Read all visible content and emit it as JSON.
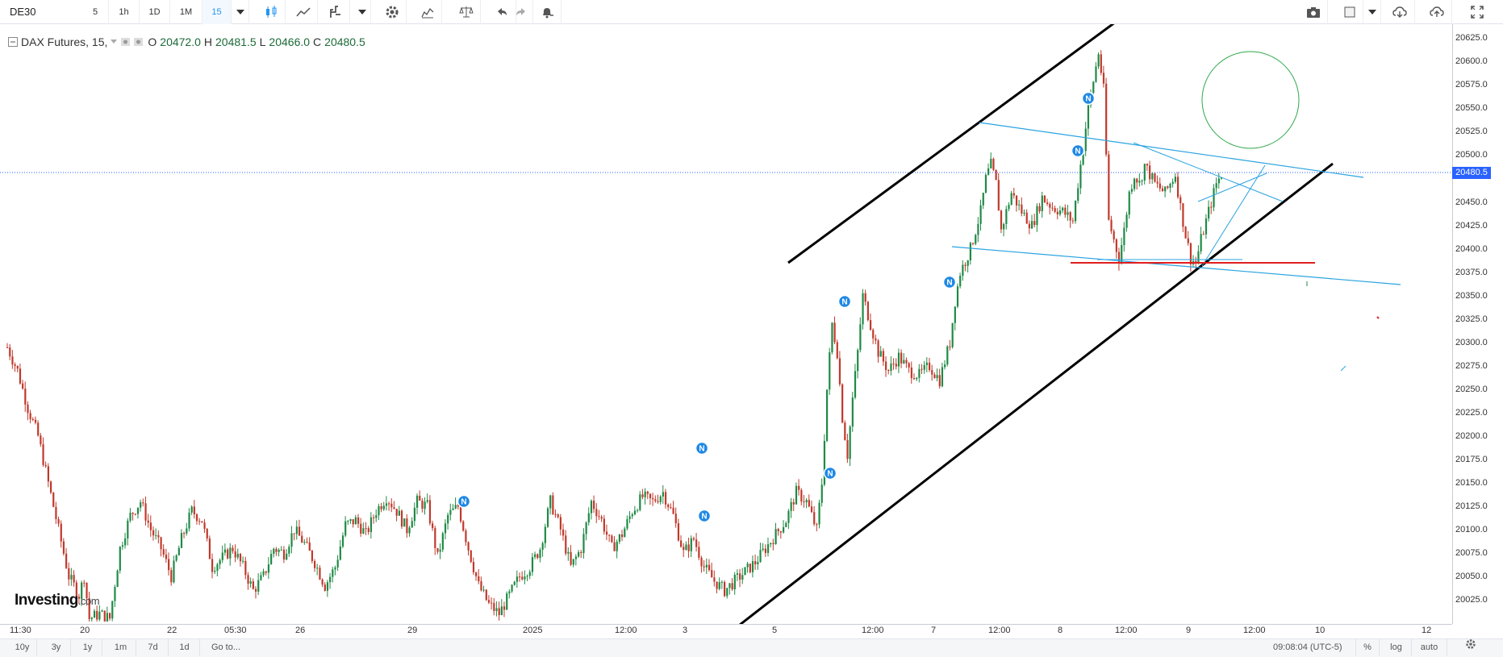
{
  "toolbar": {
    "symbol": "DE30",
    "intervals": [
      "5",
      "1h",
      "1D",
      "1M",
      "15"
    ],
    "active_interval": "15"
  },
  "legend": {
    "name": "DAX Futures, 15,",
    "open_label": "O",
    "open": "20472.0",
    "high_label": "H",
    "high": "20481.5",
    "low_label": "L",
    "low": "20466.0",
    "close_label": "C",
    "close": "20480.5"
  },
  "price_axis": {
    "labels": [
      "20625.0",
      "20600.0",
      "20575.0",
      "20550.0",
      "20525.0",
      "20500.0",
      "20450.0",
      "20425.0",
      "20400.0",
      "20375.0",
      "20350.0",
      "20325.0",
      "20300.0",
      "20275.0",
      "20250.0",
      "20225.0",
      "20200.0",
      "20175.0",
      "20150.0",
      "20125.0",
      "20100.0",
      "20075.0",
      "20050.0",
      "20025.0"
    ],
    "current_price": "20480.5"
  },
  "time_axis": {
    "labels": [
      "11:30",
      "20",
      "22",
      "05:30",
      "26",
      "29",
      "2025",
      "12:00",
      "3",
      "5",
      "12:00",
      "7",
      "12:00",
      "8",
      "12:00",
      "9",
      "12:00",
      "10",
      "12"
    ]
  },
  "bottom_bar": {
    "ranges": [
      "10y",
      "3y",
      "1y",
      "1m",
      "7d",
      "1d"
    ],
    "goto": "Go to...",
    "clock": "09:08:04 (UTC-5)",
    "percent": "%",
    "log": "log",
    "auto": "auto"
  },
  "logo": {
    "brand": "Investing",
    "suffix": ".com"
  },
  "news_marker": "N",
  "colors": {
    "up": "#1f8a45",
    "down": "#c0392b",
    "channel": "#000000",
    "trendline": "#29a3e0",
    "support": "#e01e1e",
    "circle": "#2ea84a",
    "accent": "#2962ff"
  },
  "price_series": [
    [
      0,
      20295
    ],
    [
      2,
      20270
    ],
    [
      4,
      20230
    ],
    [
      6,
      20200
    ],
    [
      8,
      20150
    ],
    [
      10,
      20100
    ],
    [
      12,
      20050
    ],
    [
      14,
      20030
    ],
    [
      15,
      20050
    ],
    [
      16,
      20005
    ],
    [
      18,
      20010
    ],
    [
      20,
      20005
    ],
    [
      22,
      20080
    ],
    [
      24,
      20115
    ],
    [
      26,
      20130
    ],
    [
      28,
      20100
    ],
    [
      30,
      20080
    ],
    [
      32,
      20050
    ],
    [
      34,
      20090
    ],
    [
      36,
      20120
    ],
    [
      38,
      20110
    ],
    [
      40,
      20060
    ],
    [
      42,
      20070
    ],
    [
      44,
      20080
    ],
    [
      46,
      20060
    ],
    [
      48,
      20035
    ],
    [
      50,
      20050
    ],
    [
      52,
      20080
    ],
    [
      54,
      20075
    ],
    [
      56,
      20100
    ],
    [
      58,
      20085
    ],
    [
      60,
      20065
    ],
    [
      62,
      20040
    ],
    [
      64,
      20060
    ],
    [
      66,
      20105
    ],
    [
      68,
      20110
    ],
    [
      70,
      20095
    ],
    [
      72,
      20120
    ],
    [
      74,
      20135
    ],
    [
      76,
      20120
    ],
    [
      78,
      20100
    ],
    [
      80,
      20130
    ],
    [
      82,
      20125
    ],
    [
      84,
      20070
    ],
    [
      86,
      20115
    ],
    [
      88,
      20125
    ],
    [
      90,
      20080
    ],
    [
      92,
      20040
    ],
    [
      94,
      20020
    ],
    [
      96,
      20010
    ],
    [
      98,
      20030
    ],
    [
      100,
      20050
    ],
    [
      102,
      20060
    ],
    [
      104,
      20080
    ],
    [
      106,
      20130
    ],
    [
      108,
      20100
    ],
    [
      110,
      20060
    ],
    [
      112,
      20080
    ],
    [
      114,
      20130
    ],
    [
      116,
      20110
    ],
    [
      118,
      20080
    ],
    [
      120,
      20095
    ],
    [
      122,
      20120
    ],
    [
      124,
      20135
    ],
    [
      126,
      20130
    ],
    [
      128,
      20140
    ],
    [
      130,
      20115
    ],
    [
      132,
      20075
    ],
    [
      134,
      20090
    ],
    [
      136,
      20060
    ],
    [
      138,
      20045
    ],
    [
      140,
      20035
    ],
    [
      142,
      20045
    ],
    [
      144,
      20055
    ],
    [
      146,
      20065
    ],
    [
      148,
      20080
    ],
    [
      150,
      20095
    ],
    [
      152,
      20110
    ],
    [
      154,
      20140
    ],
    [
      156,
      20130
    ],
    [
      158,
      20100
    ],
    [
      159,
      20150
    ],
    [
      160,
      20250
    ],
    [
      161,
      20320
    ],
    [
      162,
      20290
    ],
    [
      163,
      20220
    ],
    [
      164,
      20180
    ],
    [
      165,
      20240
    ],
    [
      166,
      20290
    ],
    [
      167,
      20350
    ],
    [
      168,
      20330
    ],
    [
      170,
      20290
    ],
    [
      172,
      20270
    ],
    [
      174,
      20285
    ],
    [
      176,
      20270
    ],
    [
      178,
      20265
    ],
    [
      180,
      20275
    ],
    [
      182,
      20260
    ],
    [
      184,
      20300
    ],
    [
      185,
      20345
    ],
    [
      186,
      20375
    ],
    [
      188,
      20400
    ],
    [
      190,
      20440
    ],
    [
      191,
      20475
    ],
    [
      192,
      20490
    ],
    [
      193,
      20470
    ],
    [
      194,
      20420
    ],
    [
      196,
      20460
    ],
    [
      198,
      20440
    ],
    [
      200,
      20425
    ],
    [
      202,
      20455
    ],
    [
      204,
      20445
    ],
    [
      206,
      20440
    ],
    [
      208,
      20430
    ],
    [
      209,
      20470
    ],
    [
      210,
      20510
    ],
    [
      211,
      20550
    ],
    [
      212,
      20580
    ],
    [
      213,
      20610
    ],
    [
      214,
      20570
    ],
    [
      215,
      20430
    ],
    [
      216,
      20410
    ],
    [
      217,
      20390
    ],
    [
      218,
      20420
    ],
    [
      219,
      20460
    ],
    [
      220,
      20480
    ],
    [
      221,
      20470
    ],
    [
      222,
      20490
    ],
    [
      224,
      20470
    ],
    [
      226,
      20460
    ],
    [
      228,
      20480
    ],
    [
      229,
      20445
    ],
    [
      230,
      20415
    ],
    [
      231,
      20390
    ],
    [
      232,
      20385
    ],
    [
      233,
      20410
    ],
    [
      234,
      20430
    ],
    [
      235,
      20450
    ],
    [
      236,
      20470
    ],
    [
      237,
      20480
    ]
  ]
}
